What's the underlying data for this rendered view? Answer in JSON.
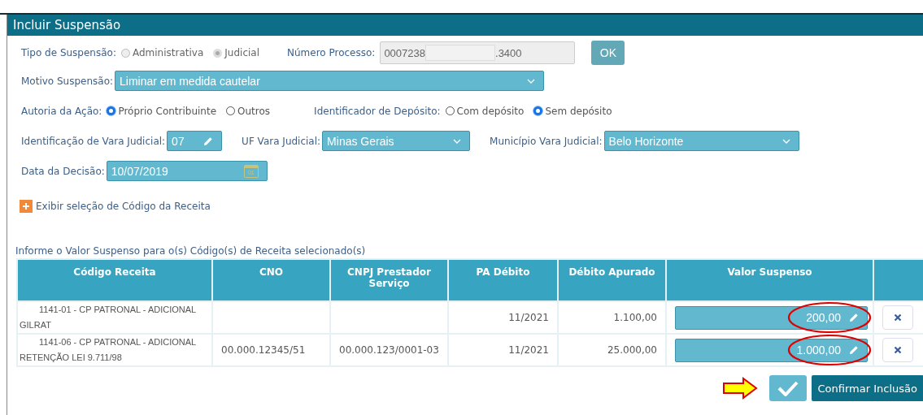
{
  "window": {
    "title": "Incluir Suspensão"
  },
  "tipo_suspensao": {
    "label": "Tipo de Suspensão:",
    "disabled": true,
    "options": [
      {
        "label": "Administrativa",
        "selected": false
      },
      {
        "label": "Judicial",
        "selected": true
      }
    ]
  },
  "numero_processo": {
    "label": "Número Processo:",
    "value_start": "0007238",
    "value_end": ".3400",
    "button": "OK"
  },
  "motivo": {
    "label": "Motivo Suspensão:",
    "value": "Liminar em medida cautelar"
  },
  "autoria": {
    "label": "Autoria da Ação:",
    "options": [
      {
        "label": "Próprio Contribuinte",
        "selected": true
      },
      {
        "label": "Outros",
        "selected": false
      }
    ]
  },
  "deposito": {
    "label": "Identificador de Depósito:",
    "options": [
      {
        "label": "Com depósito",
        "selected": false
      },
      {
        "label": "Sem depósito",
        "selected": true
      }
    ]
  },
  "vara": {
    "label": "Identificação de Vara Judicial:",
    "value": "07"
  },
  "uf": {
    "label": "UF Vara Judicial:",
    "value": "Minas Gerais"
  },
  "municipio": {
    "label": "Município Vara Judicial:",
    "value": "Belo Horizonte"
  },
  "data_decisao": {
    "label": "Data da Decisão:",
    "value": "10/07/2019",
    "calendar_day": "01"
  },
  "expand_link": "Exibir seleção de Código da Receita",
  "table": {
    "caption": "Informe o Valor Suspenso para o(s) Código(s) de Receita selecionado(s)",
    "columns": [
      "Código Receita",
      "CNO",
      "CNPJ Prestador Serviço",
      "PA Débito",
      "Débito Apurado",
      "Valor Suspenso"
    ],
    "rows": [
      {
        "codigo": "1141-01 - CP PATRONAL - ADICIONAL GILRAT",
        "cno": "",
        "cnpj": "",
        "pa": "11/2021",
        "debito": "1.100,00",
        "valor": "200,00",
        "highlighted": true
      },
      {
        "codigo": "1141-06 - CP PATRONAL - ADICIONAL RETENÇÃO LEI 9.711/98",
        "cno": "00.000.12345/51",
        "cnpj": "00.000.123/0001-03",
        "pa": "11/2021",
        "debito": "25.000,00",
        "valor": "1.000,00",
        "highlighted": true
      }
    ]
  },
  "confirm": {
    "label": "Confirmar Inclusão",
    "pointer_arrow": true
  }
}
